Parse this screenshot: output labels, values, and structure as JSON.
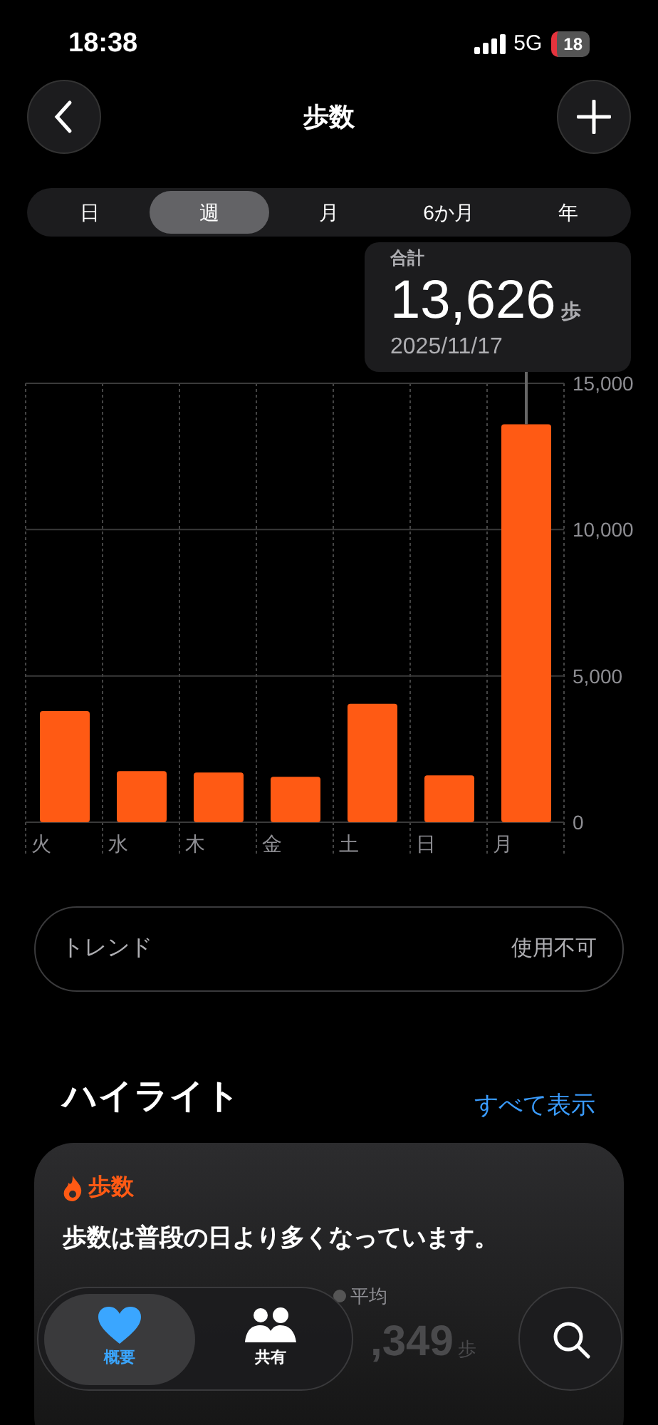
{
  "status_bar": {
    "time": "18:38",
    "network": "5G",
    "battery": "18"
  },
  "header": {
    "title": "歩数"
  },
  "tabs": [
    {
      "label": "日",
      "selected": false
    },
    {
      "label": "週",
      "selected": true
    },
    {
      "label": "月",
      "selected": false
    },
    {
      "label": "6か月",
      "selected": false
    },
    {
      "label": "年",
      "selected": false
    }
  ],
  "tooltip": {
    "label": "合計",
    "value": "13,626",
    "unit": "歩",
    "date": "2025/11/17"
  },
  "chart_data": {
    "type": "bar",
    "categories": [
      "火",
      "水",
      "木",
      "金",
      "土",
      "日",
      "月"
    ],
    "values": [
      3800,
      1750,
      1700,
      1550,
      4050,
      1600,
      13600
    ],
    "ylim": [
      0,
      15000
    ],
    "yticks": [
      {
        "value": 0,
        "label": "0"
      },
      {
        "value": 5000,
        "label": "5,000"
      },
      {
        "value": 10000,
        "label": "10,000"
      },
      {
        "value": 15000,
        "label": "15,000"
      }
    ],
    "annotations": [
      {
        "x": "月"
      }
    ]
  },
  "trend": {
    "label": "トレンド",
    "value": "使用不可"
  },
  "highlights": {
    "title": "ハイライト",
    "link": "すべて表示",
    "card": {
      "category": "歩数",
      "message": "歩数は普段の日より多くなっています。",
      "average_label": "平均",
      "average_value": ",349",
      "average_unit": "歩"
    }
  },
  "tab_bar": {
    "items": [
      {
        "label": "概要",
        "selected": true,
        "kind": "heart"
      },
      {
        "label": "共有",
        "selected": false,
        "kind": "people"
      }
    ]
  }
}
